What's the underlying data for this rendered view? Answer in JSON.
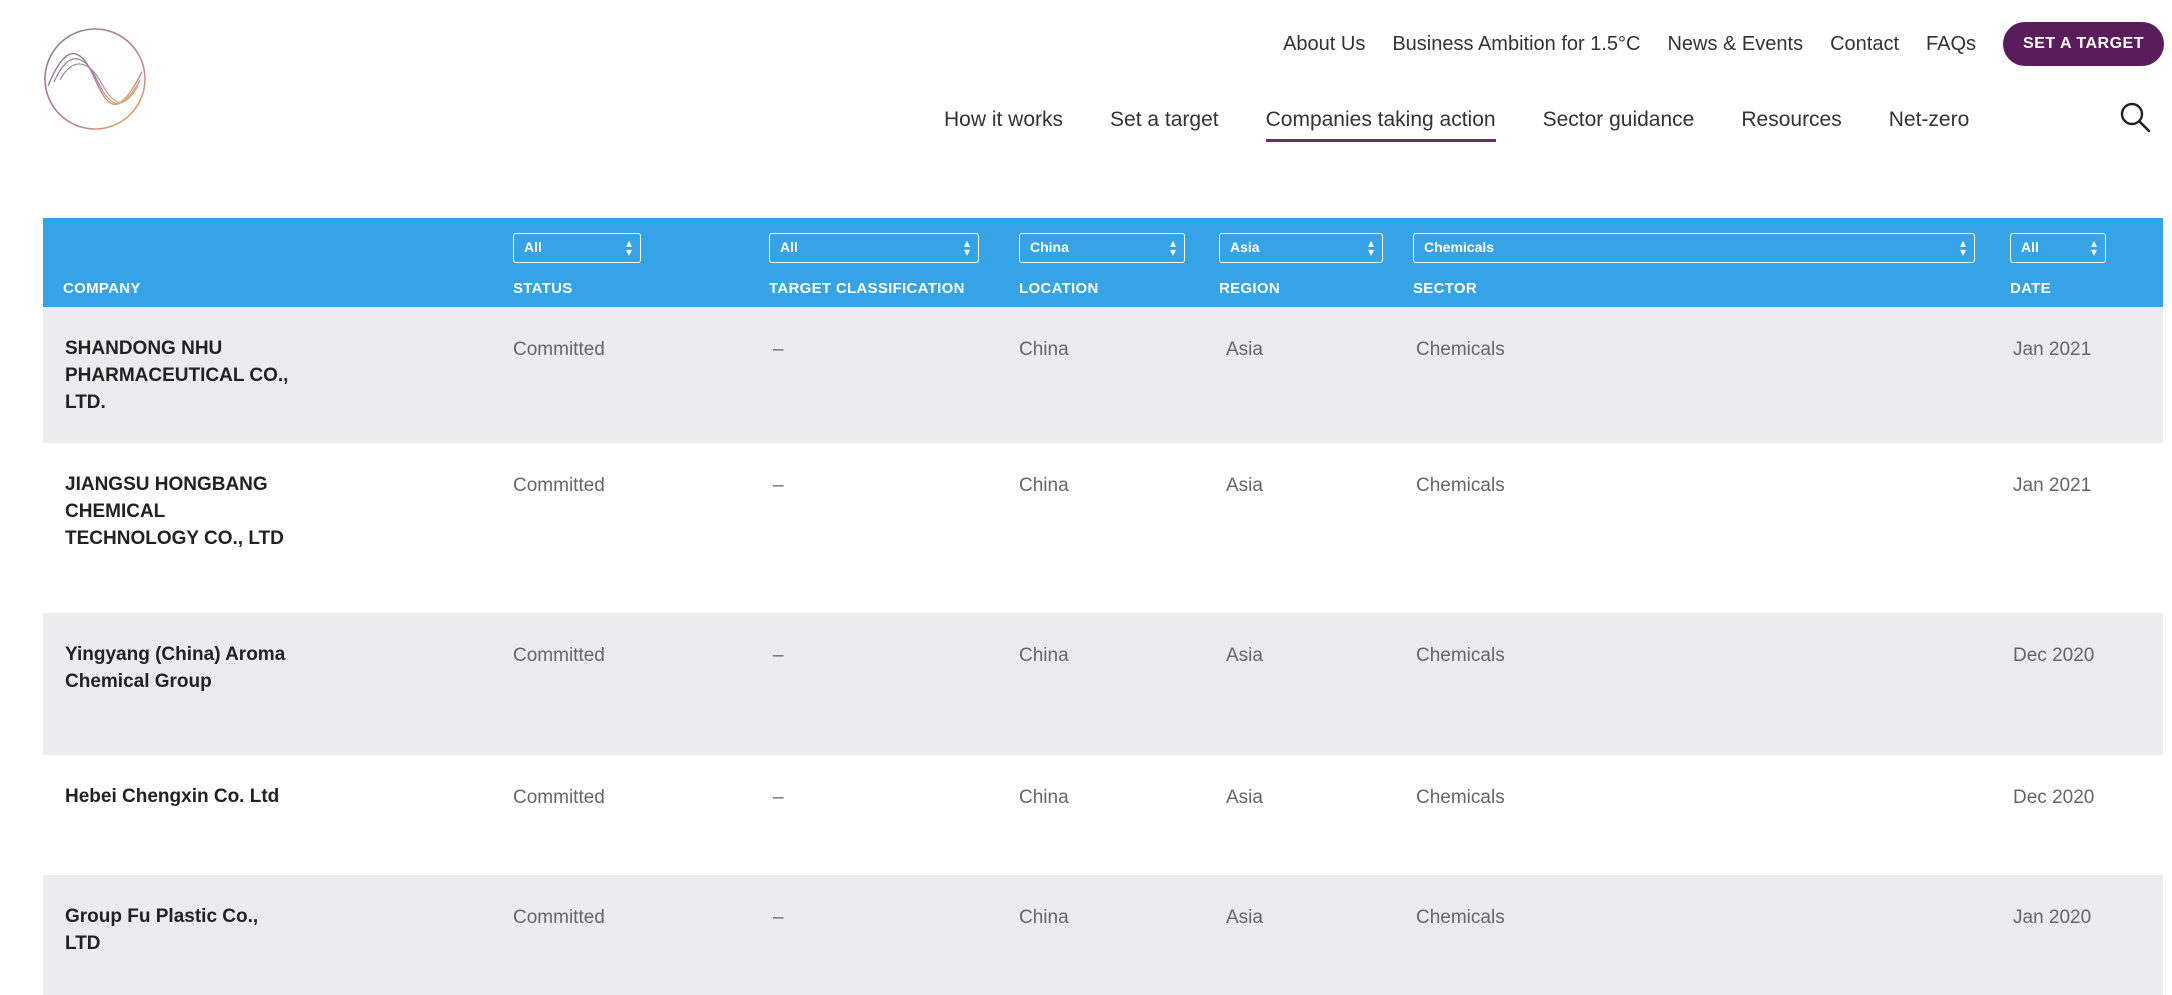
{
  "header": {
    "top_nav": [
      "About Us",
      "Business Ambition for 1.5°C",
      "News & Events",
      "Contact",
      "FAQs"
    ],
    "cta_label": "SET A TARGET",
    "main_nav": [
      "How it works",
      "Set a target",
      "Companies taking action",
      "Sector guidance",
      "Resources",
      "Net-zero"
    ],
    "active_nav": "Companies taking action",
    "icons": {
      "logo": "sbti-wave-logo",
      "search": "search-icon"
    }
  },
  "colors": {
    "header_bar": "#35a3e6",
    "cta": "#5a1d5c",
    "row_alt": "#ececf0",
    "active_underline": "#6b2a6e"
  },
  "table": {
    "columns": [
      {
        "key": "company",
        "label": "COMPANY",
        "filter": null
      },
      {
        "key": "status",
        "label": "STATUS",
        "filter": "All"
      },
      {
        "key": "target_classification",
        "label": "TARGET CLASSIFICATION",
        "filter": "All"
      },
      {
        "key": "location",
        "label": "LOCATION",
        "filter": "China"
      },
      {
        "key": "region",
        "label": "REGION",
        "filter": "Asia"
      },
      {
        "key": "sector",
        "label": "SECTOR",
        "filter": "Chemicals"
      },
      {
        "key": "date",
        "label": "DATE",
        "filter": "All"
      }
    ],
    "rows": [
      {
        "company": "SHANDONG NHU PHARMACEUTICAL CO., LTD.",
        "status": "Committed",
        "target_classification": "–",
        "location": "China",
        "region": "Asia",
        "sector": "Chemicals",
        "date": "Jan 2021"
      },
      {
        "company": "JIANGSU HONGBANG CHEMICAL TECHNOLOGY CO., LTD",
        "status": "Committed",
        "target_classification": "–",
        "location": "China",
        "region": "Asia",
        "sector": "Chemicals",
        "date": "Jan 2021"
      },
      {
        "company": "Yingyang (China) Aroma Chemical Group",
        "status": "Committed",
        "target_classification": "–",
        "location": "China",
        "region": "Asia",
        "sector": "Chemicals",
        "date": "Dec 2020"
      },
      {
        "company": "Hebei Chengxin Co. Ltd",
        "status": "Committed",
        "target_classification": "–",
        "location": "China",
        "region": "Asia",
        "sector": "Chemicals",
        "date": "Dec 2020"
      },
      {
        "company": "Group Fu Plastic Co., LTD",
        "status": "Committed",
        "target_classification": "–",
        "location": "China",
        "region": "Asia",
        "sector": "Chemicals",
        "date": "Jan 2020"
      }
    ]
  }
}
